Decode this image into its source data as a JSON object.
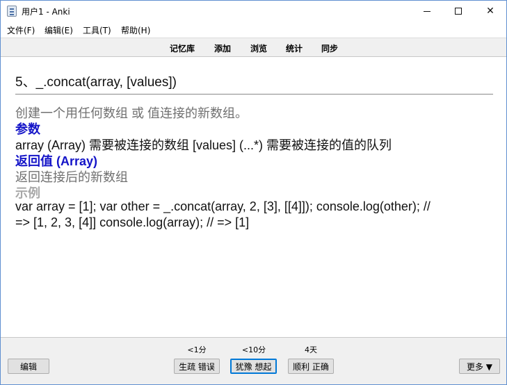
{
  "window": {
    "title": "用户1 - Anki",
    "minimize_glyph": "",
    "maximize_glyph": "",
    "close_glyph": "✕"
  },
  "menu": {
    "items": [
      {
        "label": "文件(F)"
      },
      {
        "label": "编辑(E)"
      },
      {
        "label": "工具(T)"
      },
      {
        "label": "帮助(H)"
      }
    ]
  },
  "toolbar": {
    "items": [
      {
        "label": "记忆库"
      },
      {
        "label": "添加"
      },
      {
        "label": "浏览"
      },
      {
        "label": "统计"
      },
      {
        "label": "同步"
      }
    ]
  },
  "card": {
    "question": "5、_.concat(array, [values])",
    "description": "创建一个用任何数组 或 值连接的新数组。",
    "params_heading": "参数",
    "params_text": "array (Array) 需要被连接的数组 [values] (...*) 需要被连接的值的队列",
    "returns_heading": "返回值 (Array)",
    "returns_text": "返回连接后的新数组",
    "example_heading": "示例",
    "example_line1": "var array = [1]; var other = _.concat(array, 2, [3], [[4]]); console.log(other); //",
    "example_line2": "=> [1, 2, 3, [4]] console.log(array); // => [1]"
  },
  "bottom": {
    "edit_label": "编辑",
    "more_label": "更多 ▼",
    "answers": [
      {
        "time": "<1分",
        "label": "生疏 错误"
      },
      {
        "time": "<10分",
        "label": "犹豫 想起"
      },
      {
        "time": "4天",
        "label": "顺利 正确"
      }
    ]
  }
}
